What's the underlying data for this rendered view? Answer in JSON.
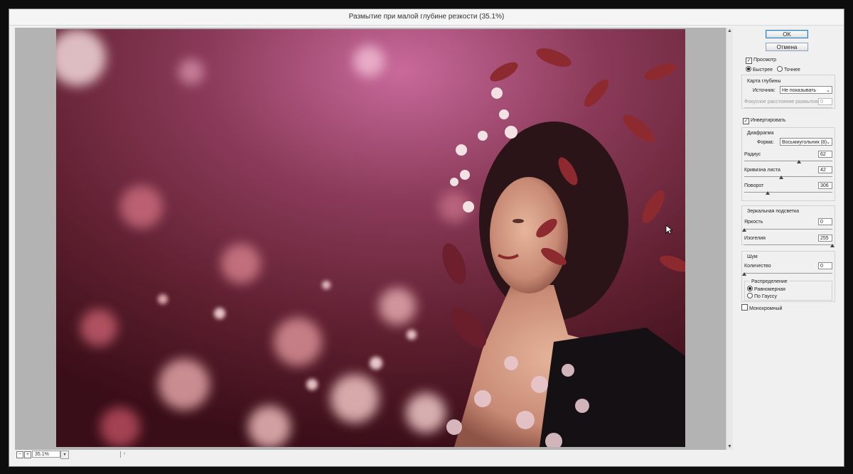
{
  "window": {
    "title": "Размытие при малой глубине резкости (35.1%)"
  },
  "statusbar": {
    "zoom": "35.1%",
    "minus_glyph": "−",
    "plus_glyph": "+",
    "dropdown_glyph": "▾",
    "scroll_left_glyph": "‹"
  },
  "panel": {
    "ok_label": "OK",
    "cancel_label": "Отмена",
    "preview_label": "Просмотр",
    "preview_checked": true,
    "speed_fast_label": "Быстрее",
    "speed_accurate_label": "Точнее",
    "depth_map": {
      "title": "Карта глубины",
      "source_label": "Источник:",
      "source_value": "Не показывать",
      "focal_label": "Фокусное расстояние размытия",
      "focal_value": "0",
      "invert_label": "Инвертировать"
    },
    "iris": {
      "title": "Диафрагма",
      "shape_label": "Форма:",
      "shape_value": "Восьмиугольник (8)",
      "radius_label": "Радиус",
      "radius_value": "62",
      "radius_level": 0.62,
      "curvature_label": "Кривизна листа",
      "curvature_value": "42",
      "curvature_level": 0.42,
      "rotation_label": "Поворот",
      "rotation_value": "306",
      "rotation_level": 0.27
    },
    "specular": {
      "title": "Зеркальная подсветка",
      "brightness_label": "Яркость",
      "brightness_value": "0",
      "brightness_level": 0,
      "threshold_label": "Изогелия",
      "threshold_value": "255",
      "threshold_level": 1
    },
    "noise": {
      "title": "Шум",
      "amount_label": "Количество",
      "amount_value": "0",
      "amount_level": 0,
      "distribution_title": "Распределение",
      "uniform_label": "Равномерная",
      "gaussian_label": "По Гауссу",
      "mono_label": "Монохромный"
    },
    "check_glyph": "✓",
    "chevron_glyph": "⌄"
  }
}
